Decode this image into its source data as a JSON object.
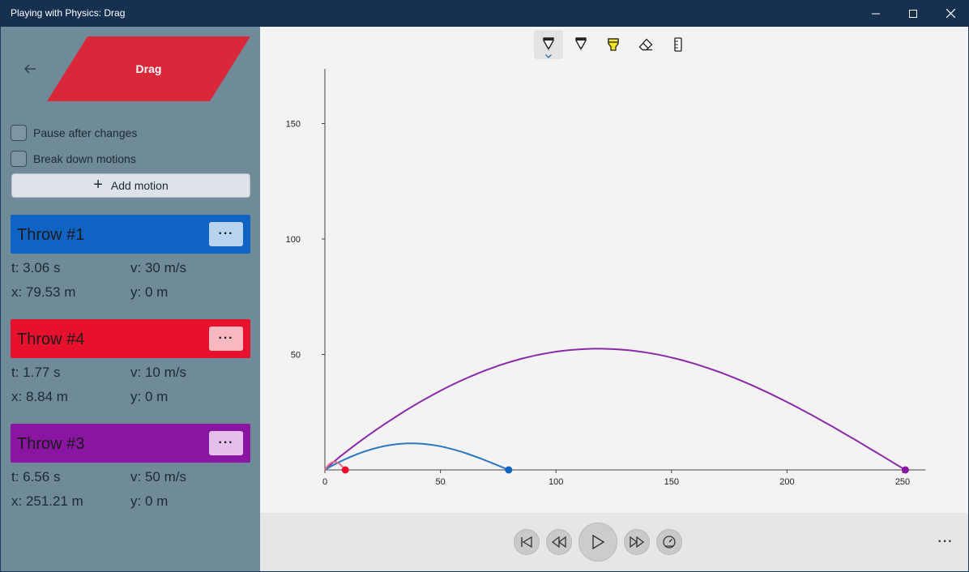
{
  "window": {
    "title": "Playing with Physics: Drag"
  },
  "sidebar": {
    "logo_label": "Drag",
    "logo_color": "#d9283a",
    "pause_label": "Pause after changes",
    "breakdown_label": "Break down motions",
    "add_motion_label": "Add motion",
    "motions": [
      {
        "name": "Throw #1",
        "color": "#0f63c2",
        "more_bg": "#b7d3f0",
        "t": "t:  3.06 s",
        "v": "v:  30 m/s",
        "x": "x:  79.53 m",
        "y": "y:  0 m"
      },
      {
        "name": "Throw #4",
        "color": "#e8112d",
        "more_bg": "#f8b8c1",
        "t": "t:  1.77 s",
        "v": "v:  10 m/s",
        "x": "x:  8.84 m",
        "y": "y:  0 m"
      },
      {
        "name": "Throw #3",
        "color": "#8a15a0",
        "more_bg": "#e4bfec",
        "t": "t:  6.56 s",
        "v": "v:  50 m/s",
        "x": "x:  251.21 m",
        "y": "y:  0 m"
      }
    ]
  },
  "toolbar": {
    "tools": [
      "ballpoint-pen-icon",
      "pencil-icon",
      "highlighter-icon",
      "eraser-icon",
      "ruler-icon"
    ]
  },
  "chart_data": {
    "type": "line",
    "xlim": [
      0,
      260
    ],
    "ylim": [
      0,
      170
    ],
    "x_ticks": [
      "0",
      "50",
      "100",
      "150",
      "200",
      "250"
    ],
    "y_ticks": [
      "50",
      "100",
      "150"
    ],
    "series": [
      {
        "color": "#8a2aa8",
        "range": 251.21,
        "peak": 52.5
      },
      {
        "color": "#2a78c0",
        "range": 79.53,
        "peak": 11.5
      },
      {
        "color": "#e06b8a",
        "range": 8.84,
        "peak": 3.5
      }
    ],
    "endpoints": [
      {
        "x": 8.84,
        "color": "#e8112d"
      },
      {
        "x": 79.53,
        "color": "#0f63c2"
      },
      {
        "x": 251.21,
        "color": "#8a15a0"
      }
    ]
  },
  "playbar": {
    "buttons": [
      "skip-back-icon",
      "rewind-icon",
      "play-icon",
      "fast-forward-icon",
      "speed-icon"
    ]
  }
}
